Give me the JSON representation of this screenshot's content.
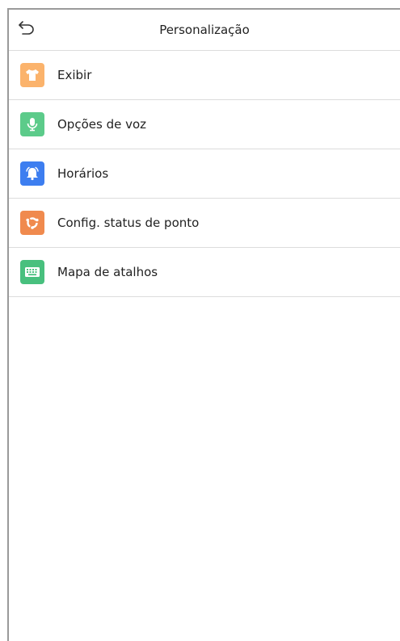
{
  "header": {
    "title": "Personalização",
    "back_icon": "back-arrow-icon"
  },
  "menu": {
    "items": [
      {
        "label": "Exibir",
        "icon": "shirt-icon",
        "color": "#FBB36C"
      },
      {
        "label": "Opções de voz",
        "icon": "microphone-icon",
        "color": "#5CCB8A"
      },
      {
        "label": "Horários",
        "icon": "bell-alarm-icon",
        "color": "#3D7EF0"
      },
      {
        "label": "Config. status de ponto",
        "icon": "status-cycle-icon",
        "color": "#F08A4E"
      },
      {
        "label": "Mapa de atalhos",
        "icon": "keyboard-icon",
        "color": "#48C07E"
      }
    ]
  }
}
